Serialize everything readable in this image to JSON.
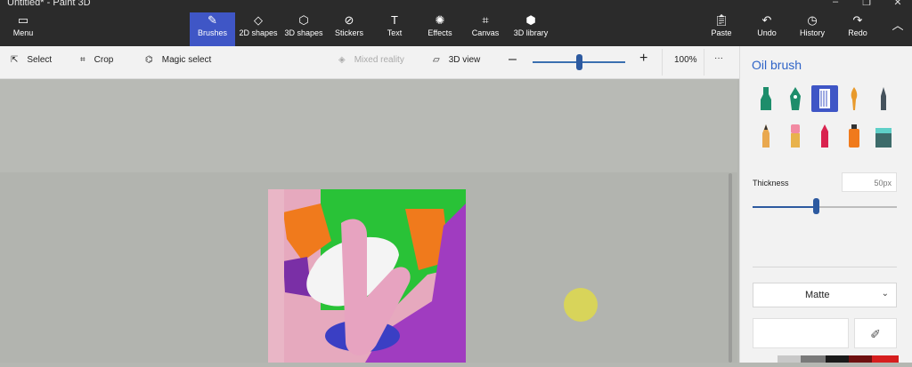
{
  "window": {
    "title": "Untitled* - Paint 3D"
  },
  "toolbar": {
    "menu": "Menu",
    "brushes": "Brushes",
    "shapes2d": "2D shapes",
    "shapes3d": "3D shapes",
    "stickers": "Stickers",
    "text": "Text",
    "effects": "Effects",
    "canvas": "Canvas",
    "library3d": "3D library",
    "paste": "Paste",
    "undo": "Undo",
    "history": "History",
    "redo": "Redo"
  },
  "subtoolbar": {
    "select": "Select",
    "crop": "Crop",
    "magic_select": "Magic select",
    "mixed_reality": "Mixed reality",
    "view3d": "3D view",
    "zoom": "100%",
    "more": "···"
  },
  "sidebar": {
    "title": "Oil brush",
    "thickness_label": "Thickness",
    "thickness_value": "50px",
    "thickness_level": 0.44,
    "finish": "Matte",
    "brushes": [
      "marker",
      "calligraphy-pen",
      "oil-brush",
      "watercolor",
      "pixel-pen",
      "pencil",
      "eraser",
      "crayon",
      "spray-can",
      "fill"
    ]
  },
  "colors": {
    "accent": "#3f56c6",
    "titlebar": "#2b2b2b"
  }
}
